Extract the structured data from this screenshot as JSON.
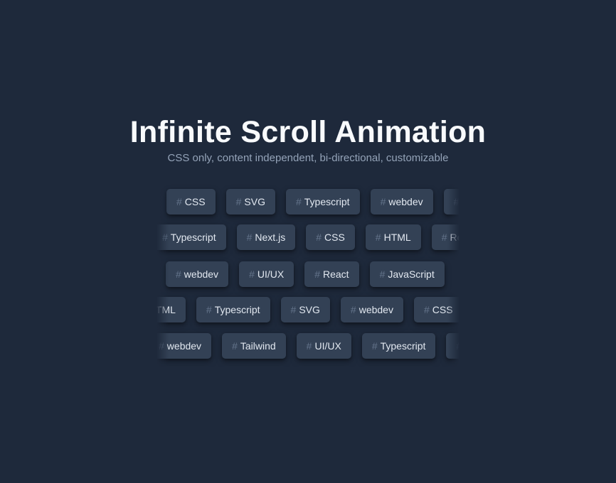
{
  "header": {
    "title": "Infinite Scroll Animation",
    "subtitle": "CSS only, content independent, bi-directional, customizable"
  },
  "hash_symbol": "#",
  "colors": {
    "background": "#1e293b",
    "tag_background": "#334155",
    "tag_text": "#e2e8f0",
    "hash": "#64748b"
  },
  "rows": [
    {
      "tags": [
        "CSS",
        "SVG",
        "Typescript",
        "webdev",
        ""
      ]
    },
    {
      "tags": [
        "Typescript",
        "Next.js",
        "CSS",
        "HTML",
        "React"
      ]
    },
    {
      "tags": [
        "webdev",
        "UI/UX",
        "React",
        "JavaScript"
      ]
    },
    {
      "tags": [
        "HTML",
        "Typescript",
        "SVG",
        "webdev",
        "CSS"
      ]
    },
    {
      "tags": [
        "webdev",
        "Tailwind",
        "UI/UX",
        "Typescript",
        ""
      ]
    }
  ]
}
